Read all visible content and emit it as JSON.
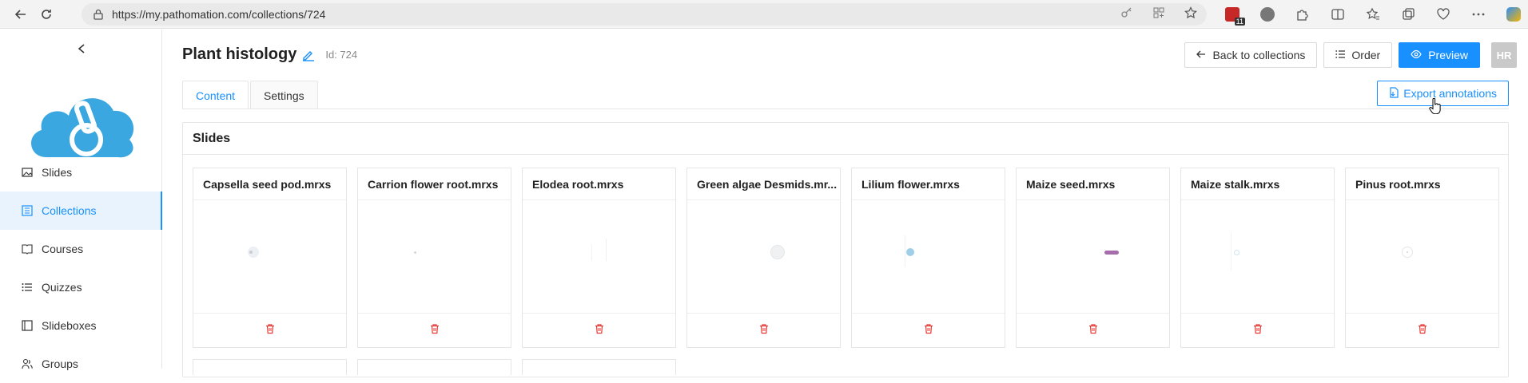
{
  "browser": {
    "url": "https://my.pathomation.com/collections/724",
    "badge_count": "11"
  },
  "sidebar": {
    "items": [
      {
        "label": "Slides",
        "icon": "image-icon"
      },
      {
        "label": "Collections",
        "icon": "collection-icon",
        "active": true
      },
      {
        "label": "Courses",
        "icon": "book-icon"
      },
      {
        "label": "Quizzes",
        "icon": "list-icon"
      },
      {
        "label": "Slideboxes",
        "icon": "box-icon"
      },
      {
        "label": "Groups",
        "icon": "users-icon"
      }
    ]
  },
  "header": {
    "title": "Plant histology",
    "id_label": "Id: 724",
    "back_label": "Back to collections",
    "order_label": "Order",
    "preview_label": "Preview",
    "avatar_initials": "HR"
  },
  "tabs": [
    {
      "label": "Content",
      "active": true
    },
    {
      "label": "Settings",
      "active": false
    }
  ],
  "export_label": "Export annotations",
  "section_title": "Slides",
  "slides": [
    {
      "name": "Capsella seed pod.mrxs"
    },
    {
      "name": "Carrion flower root.mrxs"
    },
    {
      "name": "Elodea root.mrxs"
    },
    {
      "name": "Green algae Desmids.mr..."
    },
    {
      "name": "Lilium flower.mrxs"
    },
    {
      "name": "Maize seed.mrxs"
    },
    {
      "name": "Maize stalk.mrxs"
    },
    {
      "name": "Pinus root.mrxs"
    }
  ],
  "colors": {
    "accent": "#1890ff",
    "danger": "#e53935",
    "logo": "#3aa7e0"
  }
}
